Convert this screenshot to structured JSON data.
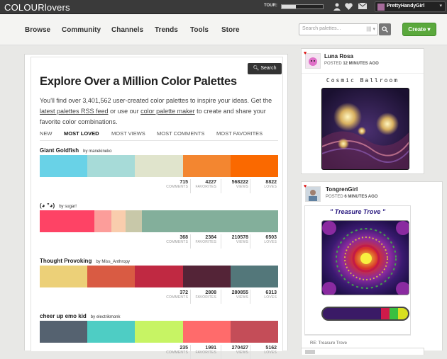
{
  "topbar": {
    "logo": "COLOURlovers",
    "tour_label": "TOUR:",
    "tour_progress": 0.35,
    "icons": [
      "user-icon",
      "heart-icon",
      "mail-icon"
    ],
    "username": "PrettyHandyGirl"
  },
  "nav": {
    "items": [
      "Browse",
      "Community",
      "Channels",
      "Trends",
      "Tools",
      "Store"
    ],
    "search_placeholder": "Search palettes...",
    "search_scope": "|||| ▾",
    "create_label": "Create ▾"
  },
  "main": {
    "search_label": "Search",
    "title": "Explore Over a Million Color Palettes",
    "intro_1": "You'll find over 3,401,562 user-created color palettes to inspire your ideas. Get the ",
    "intro_link1": "latest palettes RSS feed",
    "intro_2": " or use our ",
    "intro_link2": "color palette maker",
    "intro_3": " to create and share your favorite color combinations.",
    "tabs": [
      "NEW",
      "MOST LOVED",
      "MOST VIEWS",
      "MOST COMMENTS",
      "MOST FAVORITES"
    ],
    "active_tab": "MOST LOVED",
    "stat_labels": [
      "COMMENTS",
      "FAVORITES",
      "VIEWS",
      "LOVES"
    ],
    "palettes": [
      {
        "name": "Giant Goldfish",
        "by": "by",
        "author": "manekineko",
        "colors": [
          "#69D2E7",
          "#A7DBD8",
          "#E0E4CC",
          "#F38630",
          "#FA6900"
        ],
        "widths": [
          0.2,
          0.2,
          0.2,
          0.2,
          0.2
        ],
        "stats": [
          "715",
          "4227",
          "568222",
          "8822"
        ]
      },
      {
        "name": "(◕ ”◕)",
        "by": "by",
        "author": "sugar!",
        "colors": [
          "#FE4365",
          "#FC9D9A",
          "#F9CDAD",
          "#C8C8A9",
          "#83AF9B"
        ],
        "widths": [
          0.23,
          0.07,
          0.06,
          0.07,
          0.57
        ],
        "stats": [
          "368",
          "2384",
          "210578",
          "6503"
        ]
      },
      {
        "name": "Thought Provoking",
        "by": "by",
        "author": "Miss_Anthropy",
        "colors": [
          "#ECD078",
          "#D95B43",
          "#C02942",
          "#542437",
          "#53777A"
        ],
        "widths": [
          0.2,
          0.2,
          0.2,
          0.2,
          0.2
        ],
        "stats": [
          "372",
          "2808",
          "280855",
          "6313"
        ]
      },
      {
        "name": "cheer up emo kid",
        "by": "by",
        "author": "electrikmonk",
        "colors": [
          "#556270",
          "#4ECDC4",
          "#C7F464",
          "#FF6B6B",
          "#C44D58"
        ],
        "widths": [
          0.2,
          0.2,
          0.2,
          0.2,
          0.2
        ],
        "stats": [
          "235",
          "1991",
          "270427",
          "5162"
        ]
      }
    ]
  },
  "sidebar": {
    "cards": [
      {
        "name": "Luna Rosa",
        "posted": "POSTED",
        "time": "12 MINUTES AGO",
        "art_title": "Cosmic Ballroom"
      },
      {
        "name": "TongrenGirl",
        "posted": "POSTED",
        "time": "6 MINUTES AGO",
        "art_title": "\" Treasure Trove \"",
        "re_label": "RE: Treasure Trove"
      }
    ],
    "treasure_colors": [
      "#3a1a66",
      "#7a2a9a",
      "#d01a4a",
      "#3ac040",
      "#d8e020"
    ]
  },
  "colors": {
    "topbar_bg": "#3a3a3a",
    "create_green": "#5aa83c"
  }
}
